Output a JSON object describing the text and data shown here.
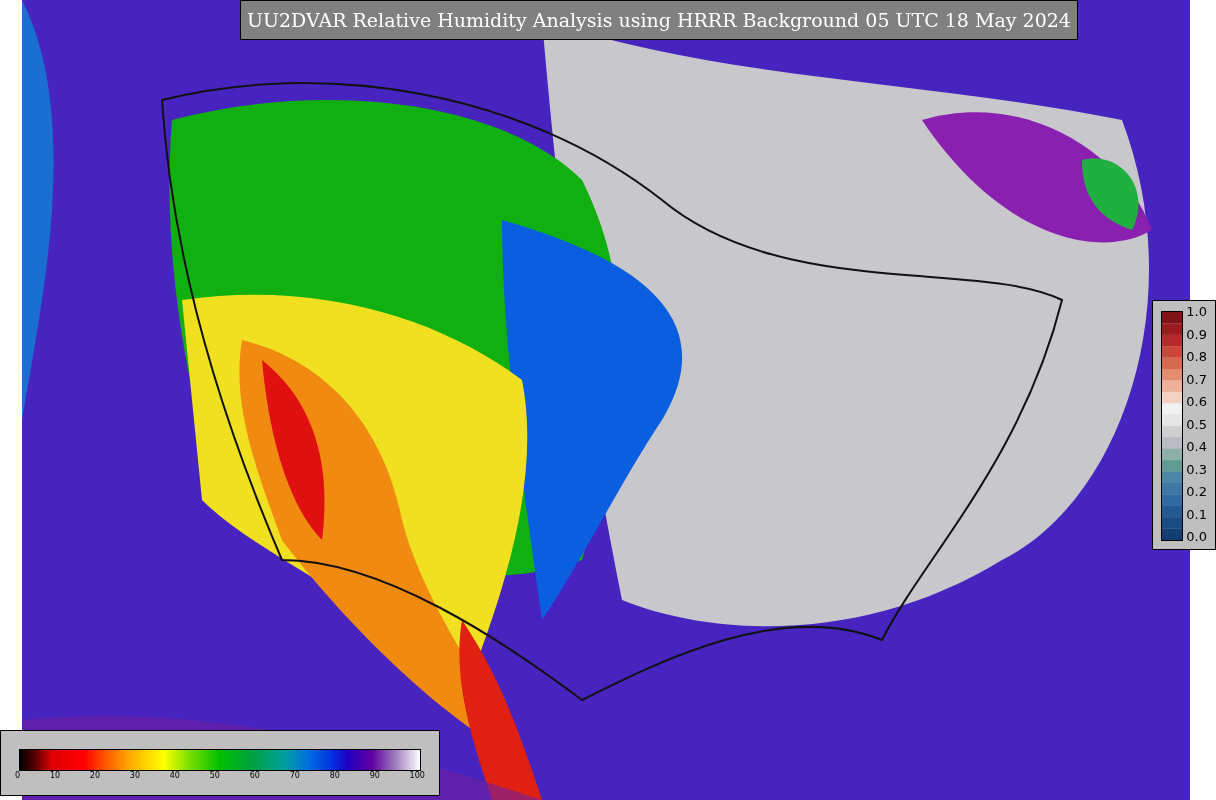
{
  "title": "UU2DVAR Relative Humidity Analysis using HRRR Background 05 UTC 18 May 2024",
  "observation_colorbar": {
    "ticks": [
      "1.0",
      "0.9",
      "0.8",
      "0.7",
      "0.6",
      "0.5",
      "0.4",
      "0.3",
      "0.2",
      "0.1",
      "0.0"
    ]
  },
  "humidity_colorbar": {
    "ticks": [
      "0",
      "10",
      "20",
      "30",
      "40",
      "50",
      "60",
      "70",
      "80",
      "90",
      "100"
    ]
  }
}
